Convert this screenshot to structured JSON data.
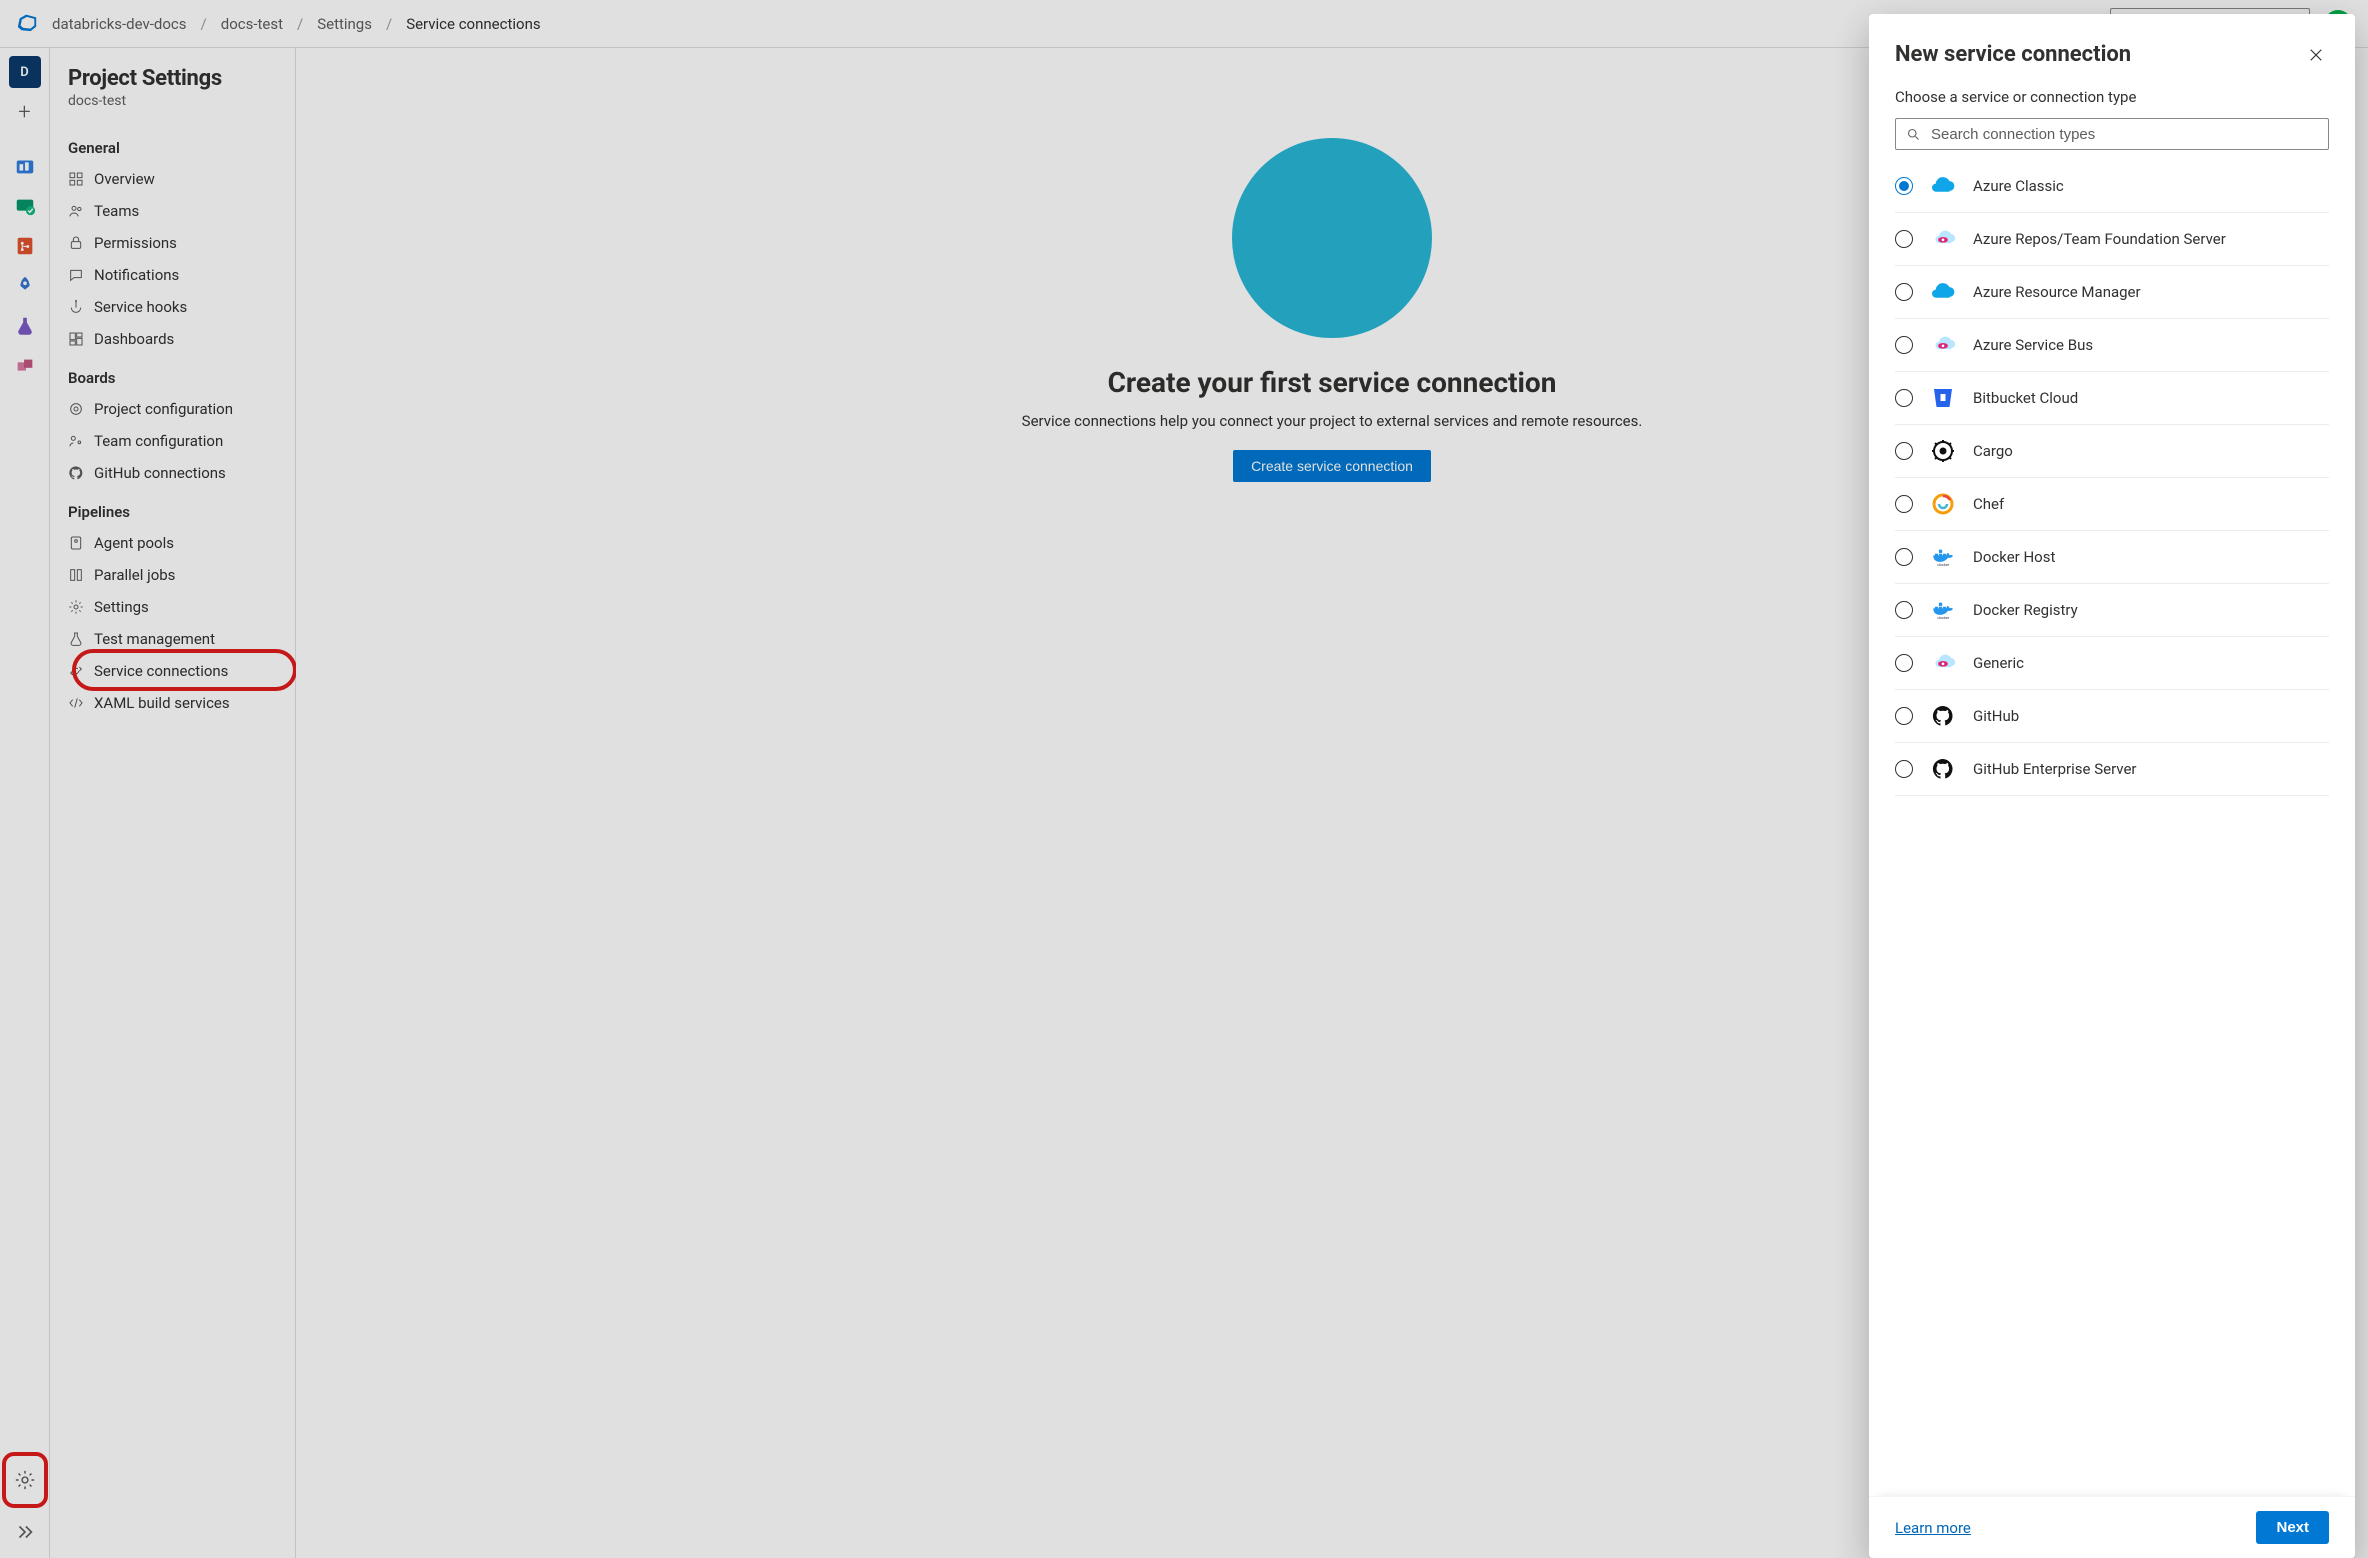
{
  "breadcrumb": {
    "items": [
      "databricks-dev-docs",
      "docs-test",
      "Settings",
      "Service connections"
    ]
  },
  "leftRail": {
    "projectInitial": "D",
    "settingsTooltip": "Project settings",
    "expandTooltip": "Expand"
  },
  "sidebar": {
    "title": "Project Settings",
    "subtitle": "docs-test",
    "groups": [
      {
        "title": "General",
        "items": [
          {
            "label": "Overview",
            "icon": "grid-icon"
          },
          {
            "label": "Teams",
            "icon": "people-icon"
          },
          {
            "label": "Permissions",
            "icon": "lock-icon"
          },
          {
            "label": "Notifications",
            "icon": "chat-icon"
          },
          {
            "label": "Service hooks",
            "icon": "hook-icon"
          },
          {
            "label": "Dashboards",
            "icon": "dashboard-icon"
          }
        ]
      },
      {
        "title": "Boards",
        "items": [
          {
            "label": "Project configuration",
            "icon": "config-icon"
          },
          {
            "label": "Team configuration",
            "icon": "team-config-icon"
          },
          {
            "label": "GitHub connections",
            "icon": "github-icon"
          }
        ]
      },
      {
        "title": "Pipelines",
        "items": [
          {
            "label": "Agent pools",
            "icon": "agent-icon"
          },
          {
            "label": "Parallel jobs",
            "icon": "parallel-icon"
          },
          {
            "label": "Settings",
            "icon": "gear-icon"
          },
          {
            "label": "Test management",
            "icon": "flask-icon"
          },
          {
            "label": "Service connections",
            "icon": "connection-icon",
            "highlighted": true
          },
          {
            "label": "XAML build services",
            "icon": "xaml-icon"
          }
        ]
      }
    ]
  },
  "main": {
    "heroTitle": "Create your first service connection",
    "heroDesc": "Service connections help you connect your project to external services and remote resources.",
    "heroButton": "Create service connection"
  },
  "dialog": {
    "title": "New service connection",
    "subtitle": "Choose a service or connection type",
    "searchPlaceholder": "Search connection types",
    "learnMore": "Learn more",
    "nextLabel": "Next",
    "options": [
      {
        "label": "Azure Classic",
        "selected": true,
        "iconName": "azure-cloud-icon",
        "iconColor": "#0ea5e9"
      },
      {
        "label": "Azure Repos/Team Foundation Server",
        "selected": false,
        "iconName": "azure-devops-icon",
        "iconColor": "#0ea5e9"
      },
      {
        "label": "Azure Resource Manager",
        "selected": false,
        "iconName": "azure-cloud-icon",
        "iconColor": "#0ea5e9"
      },
      {
        "label": "Azure Service Bus",
        "selected": false,
        "iconName": "azure-devops-icon",
        "iconColor": "#0ea5e9"
      },
      {
        "label": "Bitbucket Cloud",
        "selected": false,
        "iconName": "bitbucket-icon",
        "iconColor": "#2563eb"
      },
      {
        "label": "Cargo",
        "selected": false,
        "iconName": "cargo-icon",
        "iconColor": "#1f2937"
      },
      {
        "label": "Chef",
        "selected": false,
        "iconName": "chef-icon",
        "iconColor": "#f59e0b"
      },
      {
        "label": "Docker Host",
        "selected": false,
        "iconName": "docker-icon",
        "iconColor": "#2496ed"
      },
      {
        "label": "Docker Registry",
        "selected": false,
        "iconName": "docker-icon",
        "iconColor": "#2496ed"
      },
      {
        "label": "Generic",
        "selected": false,
        "iconName": "azure-devops-icon",
        "iconColor": "#0ea5e9"
      },
      {
        "label": "GitHub",
        "selected": false,
        "iconName": "github-icon",
        "iconColor": "#111111"
      },
      {
        "label": "GitHub Enterprise Server",
        "selected": false,
        "iconName": "github-icon",
        "iconColor": "#111111"
      }
    ]
  }
}
